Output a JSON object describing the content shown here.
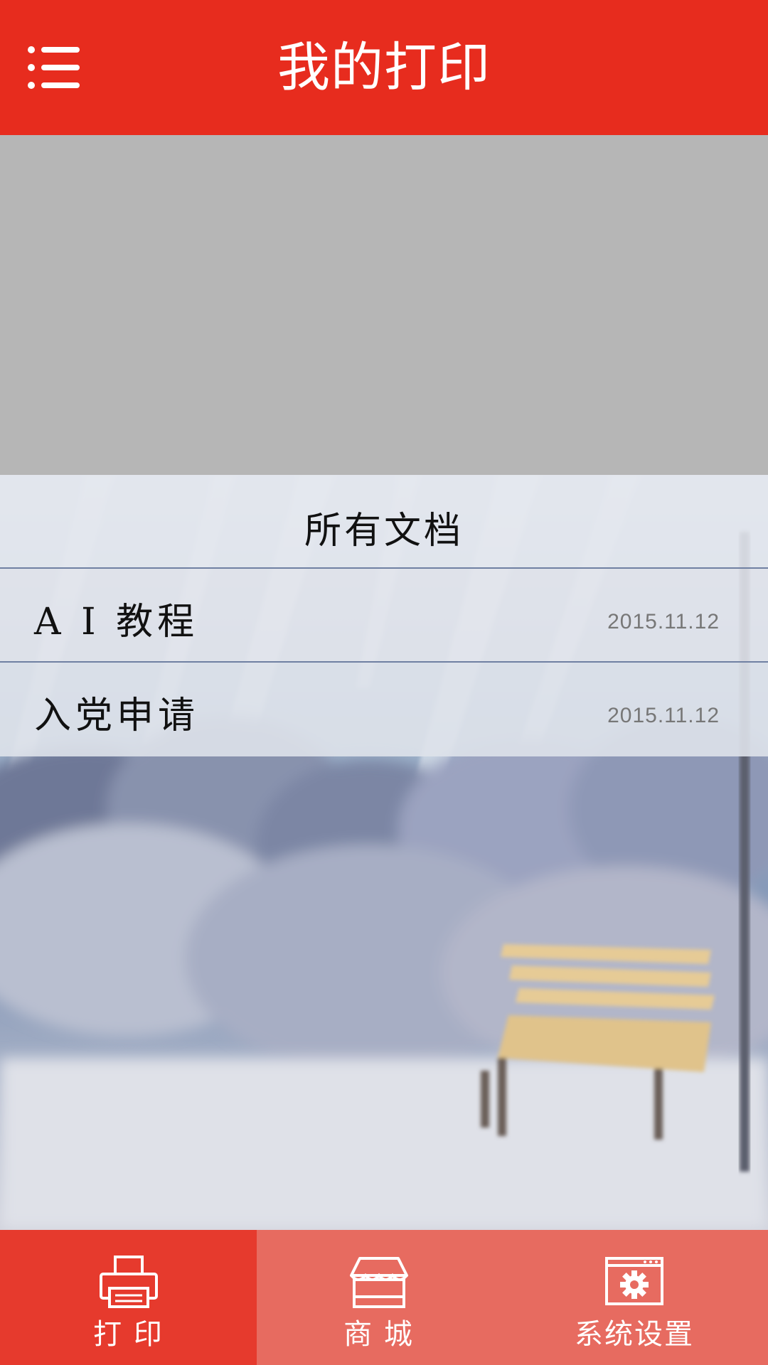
{
  "header": {
    "title": "我的打印",
    "menu_icon": "menu-list-icon"
  },
  "documents": {
    "section_title": "所有文档",
    "items": [
      {
        "name": "A I 教程",
        "date": "2015.11.12"
      },
      {
        "name": "入党申请",
        "date": "2015.11.12"
      }
    ]
  },
  "bottom_nav": {
    "items": [
      {
        "label": "打 印",
        "icon": "printer-icon",
        "active": true
      },
      {
        "label": "商 城",
        "icon": "store-icon",
        "active": false
      },
      {
        "label": "系统设置",
        "icon": "settings-window-icon",
        "active": false
      }
    ]
  },
  "colors": {
    "primary_red": "#e72c1e",
    "nav_active": "#e63a2d",
    "nav_inactive": "#e76b60",
    "banner_gray": "#b6b6b6"
  }
}
